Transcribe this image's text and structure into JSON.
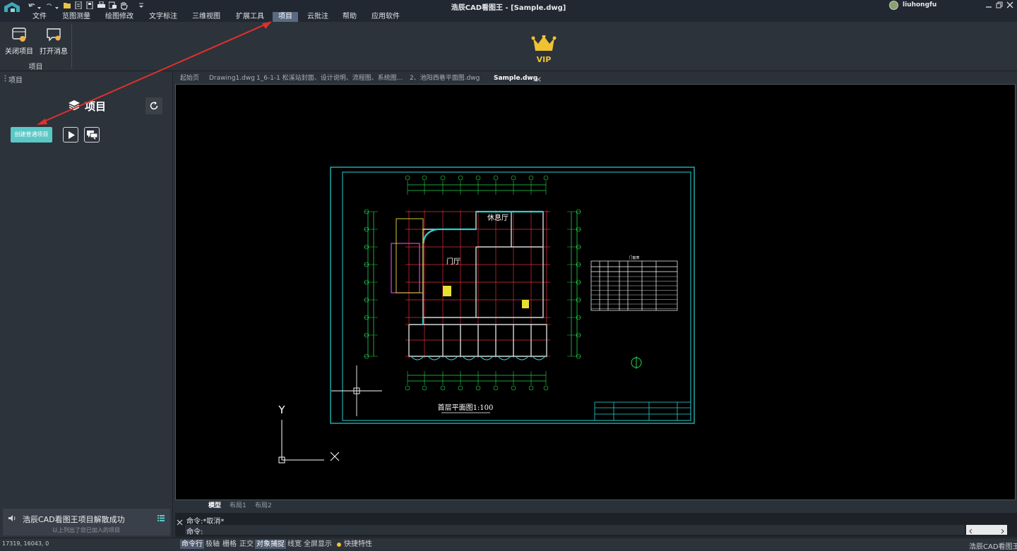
{
  "title_bar": {
    "title": "浩辰CAD看图王 - [Sample.dwg]",
    "username": "liuhongfu",
    "quick_access_icons": [
      "undo-icon",
      "redo-icon",
      "open-folder-icon",
      "new-file-icon",
      "save-icon",
      "print-icon",
      "batch-print-icon",
      "pan-hand-icon",
      "customize-icon"
    ]
  },
  "menu": {
    "items": [
      "文件",
      "览图测量",
      "绘图修改",
      "文字标注",
      "三维视图",
      "扩展工具",
      "项目",
      "云批注",
      "帮助",
      "应用软件"
    ],
    "active": "项目"
  },
  "ribbon": {
    "buttons": [
      {
        "label": "关闭项目",
        "icon": "close-project-icon"
      },
      {
        "label": "打开消息",
        "icon": "open-message-icon"
      }
    ],
    "group_label": "项目",
    "vip_label": "VIP"
  },
  "left_panel": {
    "header": "项目",
    "title": "项目",
    "create_button": "创建普通项目",
    "notification_title": "浩辰CAD看图王项目解散成功",
    "notification_sub": "以上列出了您已加入的项目"
  },
  "doc_tabs": [
    "起始页",
    "Drawing1.dwg",
    "1_6-1-1 松溪站封面、设计说明、流程图、系统图...",
    "2、池阳西巷平面图.dwg",
    "Sample.dwg"
  ],
  "active_doc_tab": "Sample.dwg",
  "drawing": {
    "plan_title": "首层平面图1:100",
    "room_lounge": "休息厅",
    "room_lobby": "门厅",
    "table_title": "门窗表",
    "axis_y": "Y",
    "axis_x": "X"
  },
  "layout_tabs": [
    "模型",
    "布局1",
    "布局2"
  ],
  "active_layout": "模型",
  "command": {
    "history": "命令:*取消*",
    "prompt": "命令:"
  },
  "status": {
    "coords": "17319, 16043, 0",
    "buttons": [
      "命令行",
      "极轴",
      "栅格",
      "正交",
      "对象捕捉",
      "线宽",
      "全屏显示"
    ],
    "active_buttons": [
      "命令行",
      "对象捕捉"
    ],
    "quick_props": "快捷特性",
    "app_name": "浩辰CAD看图王"
  },
  "colors": {
    "accent": "#5bc8c6",
    "arrow": "#e0302a",
    "vip_gold": "#f0c232",
    "menu_active": "#596a82"
  }
}
